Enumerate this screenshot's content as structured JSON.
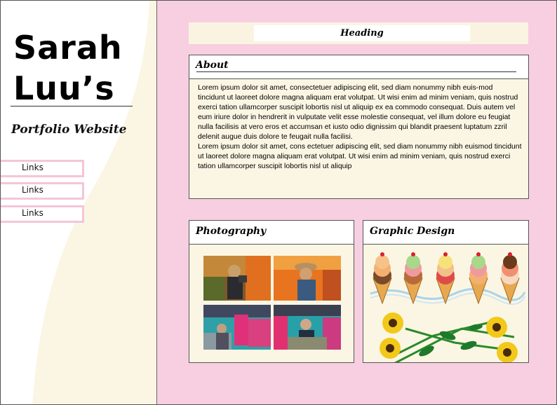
{
  "sidebar": {
    "name_line1": "Sarah",
    "name_line2": "Luu’s",
    "subtitle": "Portfolio Website",
    "links": [
      {
        "label": "Links"
      },
      {
        "label": "Links"
      },
      {
        "label": "Links"
      }
    ]
  },
  "header": {
    "heading": "Heading"
  },
  "about": {
    "title": "About",
    "paragraph1": "Lorem ipsum dolor sit amet, consectetuer adipiscing elit, sed diam nonummy nibh euis-mod tincidunt ut laoreet dolore magna aliquam erat volutpat. Ut wisi enim ad minim veniam, quis nostrud exerci tation ullamcorper suscipit lobortis nisl ut aliquip ex ea commodo consequat. Duis autem vel eum iriure dolor in hendrerit in vulputate velit esse molestie consequat, vel illum dolore eu feugiat nulla facilisis at vero eros et accumsan et iusto odio dignissim qui blandit praesent luptatum zzril delenit augue duis dolore te feugait nulla facilisi.",
    "paragraph2": "Lorem ipsum dolor sit amet, cons ectetuer adipiscing elit, sed diam nonummy nibh euismod tincidunt ut laoreet dolore magna aliquam erat volutpat. Ut wisi enim ad minim veniam, quis nostrud exerci tation ullamcorper suscipit lobortis nisl ut aliquip"
  },
  "photography": {
    "title": "Photography",
    "photos": [
      "photo-icon",
      "photo-icon",
      "photo-icon",
      "photo-icon"
    ]
  },
  "graphic_design": {
    "title": "Graphic Design",
    "icons": [
      "ice-cream-cone-icon",
      "sunflower-icon"
    ]
  },
  "colors": {
    "sidebar_bg": "#fbf6e4",
    "main_bg": "#f7cfe0",
    "link_border": "#f5c5d8",
    "panel_bg": "#fbf6e4"
  }
}
